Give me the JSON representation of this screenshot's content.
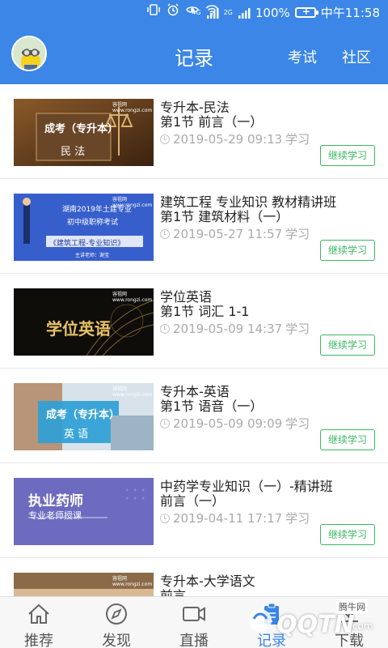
{
  "status_bar": {
    "battery_percent": "100%",
    "signal_label_1": "4G",
    "signal_label_2": "2G",
    "time": "中午11:58"
  },
  "header": {
    "title": "记录",
    "nav_exam": "考试",
    "nav_community": "社区"
  },
  "records": [
    {
      "title": "专升本-民法",
      "lesson": "第1节 前言（一）",
      "time": "2019-05-29 09:13",
      "status": "学习",
      "button": "继续学习",
      "thumb": {
        "line1": "成考（专升本）",
        "line2": "民 法",
        "brand": "容祖网 www.rongzi.com"
      }
    },
    {
      "title": "建筑工程 专业知识 教材精讲班",
      "lesson": "第1节 建筑材料（一）",
      "time": "2019-05-27 11:57",
      "status": "学习",
      "button": "继续学习",
      "thumb": {
        "line1": "湖南2019年土建专业",
        "line2": "初中级职称考试",
        "line3": "《建筑工程-专业知识》",
        "line4": "主讲老师：谢宝",
        "brand": "容祖网 www.rongzi.com"
      }
    },
    {
      "title": "学位英语",
      "lesson": "第1节 词汇 1-1",
      "time": "2019-05-09 14:37",
      "status": "学习",
      "button": "继续学习",
      "thumb": {
        "line1": "学位英语",
        "brand": "容祖网 www.rongzi.com"
      }
    },
    {
      "title": "专升本-英语",
      "lesson": "第1节 语音（一）",
      "time": "2019-05-09 09:09",
      "status": "学习",
      "button": "继续学习",
      "thumb": {
        "line1": "成考（专升本）",
        "line2": "英 语",
        "brand": "容祖网 www.rongzi.com"
      }
    },
    {
      "title": "中药学专业知识（一）-精讲班",
      "lesson": "前言（一）",
      "time": "2019-04-11 17:17",
      "status": "学习",
      "button": "继续学习",
      "thumb": {
        "line1": "执业药师",
        "line2": "专业老师授课"
      }
    },
    {
      "title": "专升本-大学语文",
      "lesson": "前言",
      "time": "",
      "status": "",
      "button": "",
      "thumb": {
        "brand": "容祖网 www.rongzi.com"
      }
    }
  ],
  "tabs": [
    {
      "label": "推荐",
      "icon": "home-icon"
    },
    {
      "label": "发现",
      "icon": "compass-icon"
    },
    {
      "label": "直播",
      "icon": "video-icon"
    },
    {
      "label": "记录",
      "icon": "clipboard-icon",
      "active": true
    },
    {
      "label": "下载",
      "icon": "download-icon"
    }
  ],
  "watermark": {
    "brand": "QQTN",
    "sub": "腾牛网",
    "suffix": ".com"
  },
  "colors": {
    "header": "#3b86e6",
    "button": "#3cb763",
    "active_tab": "#3b86e6"
  }
}
